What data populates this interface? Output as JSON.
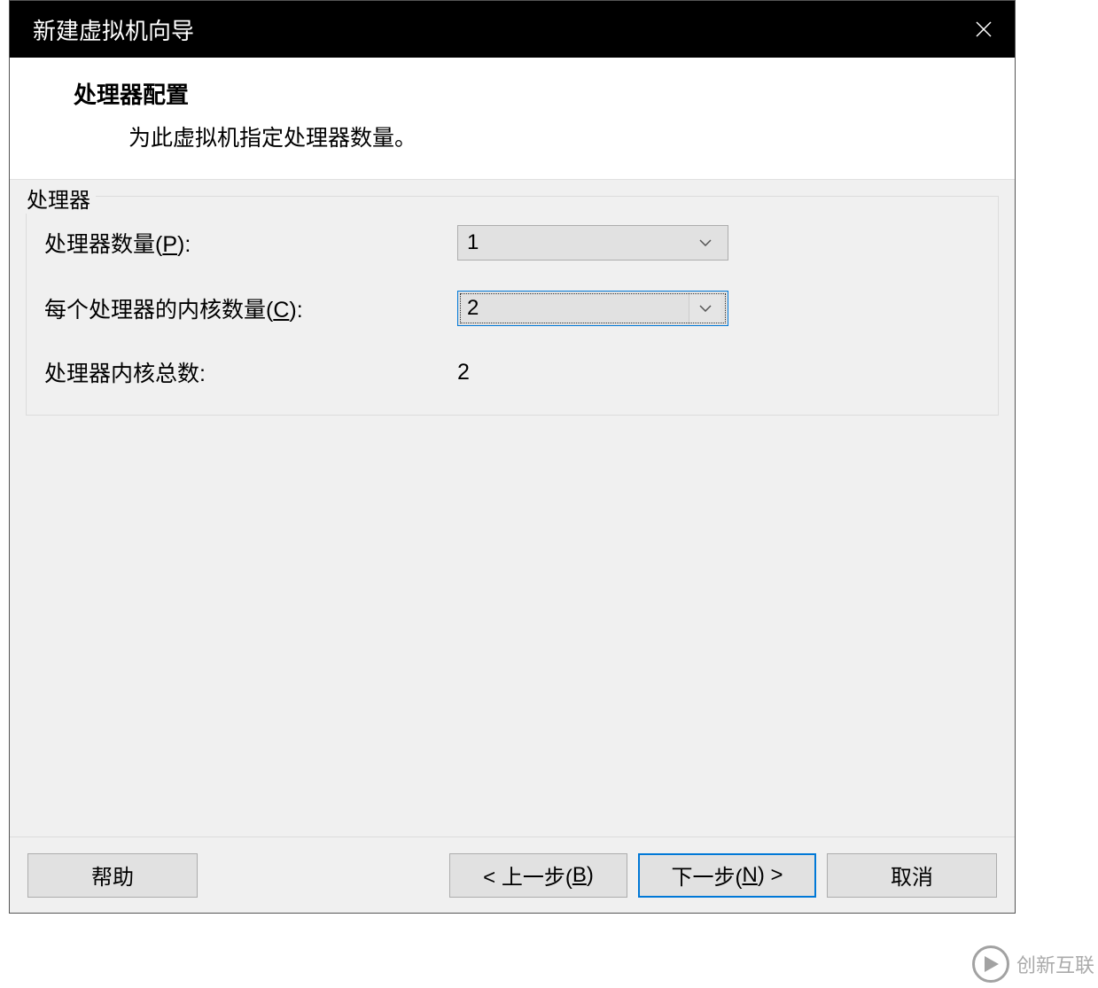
{
  "window": {
    "title": "新建虚拟机向导"
  },
  "header": {
    "title": "处理器配置",
    "subtitle": "为此虚拟机指定处理器数量。"
  },
  "group": {
    "legend": "处理器",
    "rows": {
      "processor_count": {
        "label_pre": "处理器数量(",
        "accel": "P",
        "label_post": "):",
        "value": "1"
      },
      "cores_per_processor": {
        "label_pre": "每个处理器的内核数量(",
        "accel": "C",
        "label_post": "):",
        "value": "2"
      },
      "total_cores": {
        "label": "处理器内核总数:",
        "value": "2"
      }
    }
  },
  "buttons": {
    "help": "帮助",
    "back_pre": "< 上一步(",
    "back_accel": "B",
    "back_post": ")",
    "next_pre": "下一步(",
    "next_accel": "N",
    "next_post": ") >",
    "cancel": "取消"
  },
  "watermark": {
    "text": "创新互联"
  }
}
